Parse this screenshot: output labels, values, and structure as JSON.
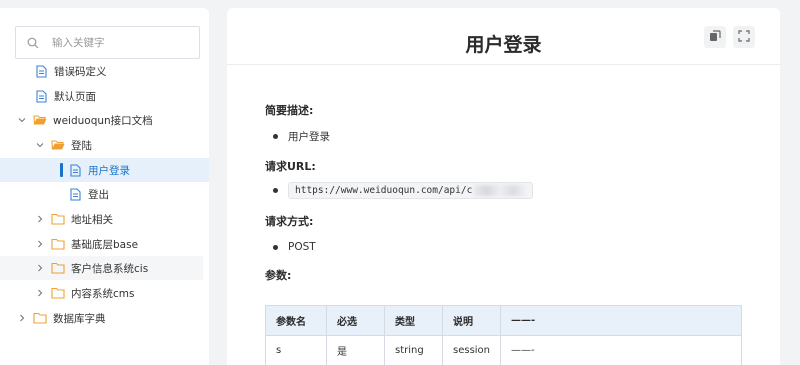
{
  "search": {
    "placeholder": "输入关键字"
  },
  "tree": [
    {
      "label": "错误码定义",
      "type": "doc"
    },
    {
      "label": "默认页面",
      "type": "doc"
    },
    {
      "label": "weiduoqun接口文档",
      "type": "folder-open"
    },
    {
      "label": "登陆",
      "type": "folder-open"
    },
    {
      "label": "用户登录",
      "type": "doc",
      "active": true
    },
    {
      "label": "登出",
      "type": "doc"
    },
    {
      "label": "地址相关",
      "type": "folder"
    },
    {
      "label": "基础底层base",
      "type": "folder"
    },
    {
      "label": "客户信息系统cis",
      "type": "folder"
    },
    {
      "label": "内容系统cms",
      "type": "folder"
    },
    {
      "label": "数据库字典",
      "type": "folder"
    }
  ],
  "main": {
    "title": "用户登录",
    "copy_icon": "copy-icon",
    "fullscreen_icon": "fullscreen-icon",
    "brief_label": "简要描述:",
    "brief_value": "用户登录",
    "url_label": "请求URL:",
    "url_value": "https://www.weiduoqun.com/api/c",
    "method_label": "请求方式:",
    "method_value": "POST",
    "params_label": "参数:",
    "table": {
      "headers": [
        "参数名",
        "必选",
        "类型",
        "说明",
        "——-"
      ],
      "rows": [
        [
          "s",
          "是",
          "string",
          "session",
          "——-"
        ]
      ]
    }
  },
  "colors": {
    "accent": "#1a73c8",
    "folder": "#f0a030",
    "doc": "#3b82d6"
  }
}
